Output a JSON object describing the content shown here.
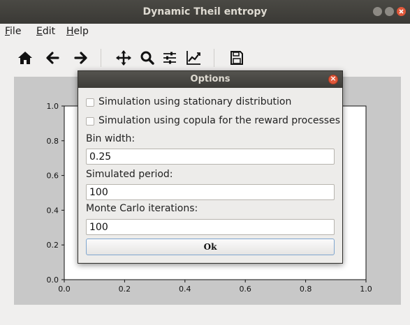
{
  "window": {
    "title": "Dynamic Theil entropy"
  },
  "menu": {
    "file": {
      "mnemonic": "F",
      "rest": "ile"
    },
    "edit": {
      "mnemonic": "E",
      "rest": "dit"
    },
    "help": {
      "mnemonic": "H",
      "rest": "elp"
    }
  },
  "toolbar": {
    "icons": [
      "home-icon",
      "back-arrow-icon",
      "forward-arrow-icon",
      "pan-icon",
      "zoom-icon",
      "configure-subplots-icon",
      "edit-axes-icon",
      "save-icon"
    ]
  },
  "plot": {
    "x_ticks": [
      "0.0",
      "0.2",
      "0.4",
      "0.6",
      "0.8",
      "1.0"
    ],
    "y_ticks": [
      "0.0",
      "0.2",
      "0.4",
      "0.6",
      "0.8",
      "1.0"
    ]
  },
  "chart_data": {
    "type": "line",
    "xlim": [
      0,
      1
    ],
    "ylim": [
      0,
      1
    ],
    "series": [],
    "grid": false
  },
  "dialog": {
    "title": "Options",
    "checkbox_stationary": "Simulation using stationary distribution",
    "checkbox_copula": "Simulation using copula for the reward processes",
    "bin_width_label": "Bin width:",
    "bin_width_value": "0.25",
    "simulated_period_label": "Simulated period:",
    "simulated_period_value": "100",
    "monte_carlo_label": "Monte Carlo iterations:",
    "monte_carlo_value": "100",
    "ok_label": "Ok"
  },
  "colors": {
    "titlebar": "#3a3935",
    "figure_background": "#c8c8c8",
    "close_button": "#e0583a",
    "ok_border": "#7fa6cf"
  }
}
